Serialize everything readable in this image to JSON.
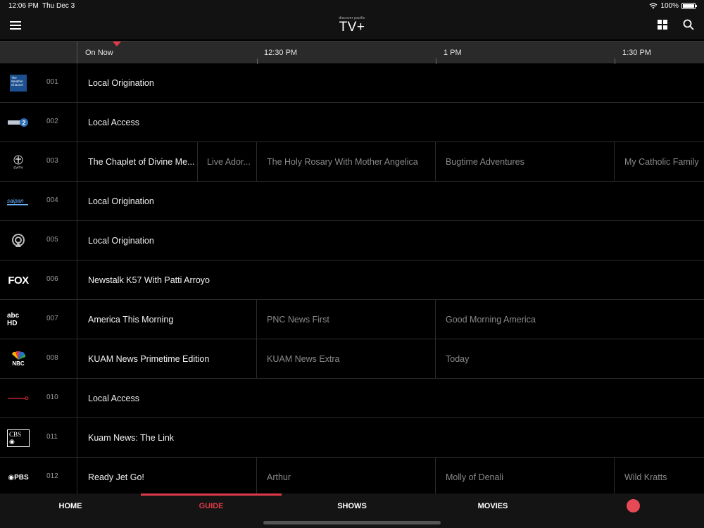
{
  "status": {
    "time": "12:06 PM",
    "date": "Thu Dec 3",
    "battery": "100%"
  },
  "header": {
    "logo_sub": "discover pacific",
    "logo_main": "TV+"
  },
  "timeline": {
    "labels": [
      "On Now",
      "12:30 PM",
      "1 PM",
      "1:30 PM"
    ]
  },
  "channels": [
    {
      "num": "001",
      "logo": "weather-channel-logo",
      "logo_text": "The Weather Channel",
      "programs": [
        {
          "title": "Local Origination"
        }
      ]
    },
    {
      "num": "002",
      "logo": "channel-2-logo",
      "logo_text": "2",
      "programs": [
        {
          "title": "Local Access"
        }
      ]
    },
    {
      "num": "003",
      "logo": "ewtn-logo",
      "logo_text": "EWTN",
      "programs": [
        {
          "title": "The Chaplet of Divine Me..."
        },
        {
          "title": "Live Ador..."
        },
        {
          "title": "The Holy Rosary With Mother Angelica"
        },
        {
          "title": "Bugtime Adventures"
        },
        {
          "title": "My Catholic Family"
        }
      ]
    },
    {
      "num": "004",
      "logo": "saipan-logo",
      "logo_text": "saipan",
      "programs": [
        {
          "title": "Local Origination"
        }
      ]
    },
    {
      "num": "005",
      "logo": "broadcast-icon",
      "logo_text": "",
      "programs": [
        {
          "title": "Local Origination"
        }
      ]
    },
    {
      "num": "006",
      "logo": "fox-logo",
      "logo_text": "FOX",
      "programs": [
        {
          "title": "Newstalk K57 With Patti Arroyo"
        }
      ]
    },
    {
      "num": "007",
      "logo": "abc-hd-logo",
      "logo_text": "abc HD",
      "programs": [
        {
          "title": "America This Morning"
        },
        {
          "title": "PNC News First"
        },
        {
          "title": "Good Morning America"
        }
      ]
    },
    {
      "num": "008",
      "logo": "nbc-logo",
      "logo_text": "NBC",
      "programs": [
        {
          "title": "KUAM News Primetime Edition"
        },
        {
          "title": "KUAM News Extra"
        },
        {
          "title": "Today"
        }
      ]
    },
    {
      "num": "010",
      "logo": "red-line-logo",
      "logo_text": "",
      "programs": [
        {
          "title": "Local Access"
        }
      ]
    },
    {
      "num": "011",
      "logo": "cbs-logo",
      "logo_text": "CBS",
      "programs": [
        {
          "title": "Kuam News: The Link"
        }
      ]
    },
    {
      "num": "012",
      "logo": "pbs-logo",
      "logo_text": "PBS",
      "programs": [
        {
          "title": "Ready Jet Go!"
        },
        {
          "title": "Arthur"
        },
        {
          "title": "Molly of Denali"
        },
        {
          "title": "Wild Kratts"
        }
      ]
    }
  ],
  "nav": {
    "items": [
      "HOME",
      "GUIDE",
      "SHOWS",
      "MOVIES"
    ],
    "active": "GUIDE"
  },
  "colors": {
    "accent": "#e03a48",
    "record": "#e64a56",
    "background": "#000000"
  }
}
